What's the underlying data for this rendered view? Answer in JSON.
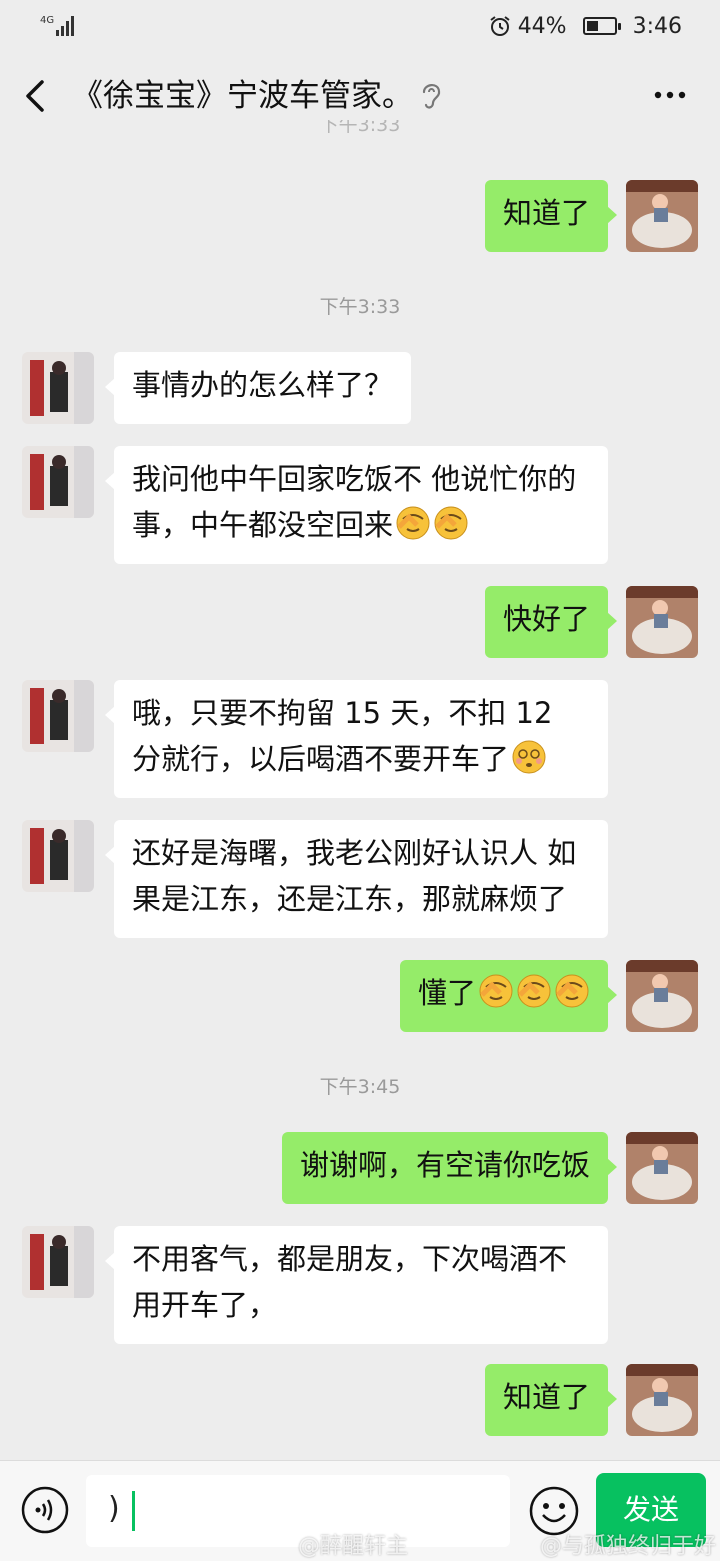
{
  "status_bar": {
    "network": "4G",
    "battery": "44%",
    "battery_level": 0.44,
    "time": "3:46"
  },
  "nav": {
    "title": "《徐宝宝》宁波车管家。",
    "back_icon": "chevron-left-icon",
    "mode_icon": "ear-icon",
    "more_icon": "more-dots-icon"
  },
  "timestamps": {
    "t1": "下午3:33",
    "t2": "下午3:45"
  },
  "messages": [
    {
      "side": "out",
      "text": "知道了"
    },
    {
      "side": "in",
      "text": "事情办的怎么样了？"
    },
    {
      "side": "in",
      "text": "我问他中午回家吃饭不 他说忙你的事，中午都没空回来",
      "emoji": [
        "facepalm",
        "facepalm"
      ]
    },
    {
      "side": "out",
      "text": "快好了"
    },
    {
      "side": "in",
      "text": "哦，只要不拘留 15 天，不扣 12 分就行，以后喝酒不要开车了",
      "emoji": [
        "dizzy"
      ]
    },
    {
      "side": "in",
      "text": "还好是海曙，我老公刚好认识人 如果是江东，还是江东，那就麻烦了"
    },
    {
      "side": "out",
      "text": "懂了",
      "emoji": [
        "facepalm",
        "facepalm",
        "facepalm"
      ]
    },
    {
      "side": "out",
      "text": "谢谢啊，有空请你吃饭"
    },
    {
      "side": "in",
      "text": "不用客气，都是朋友，下次喝酒不用开车了，"
    },
    {
      "side": "out",
      "text": "知道了"
    }
  ],
  "input_bar": {
    "voice_icon": "voice-icon",
    "input_value": ")",
    "emoji_icon": "smiley-icon",
    "send_label": "发送"
  },
  "watermarks": {
    "left": "@醉醒轩主",
    "right": "@与孤独终归于好"
  },
  "colors": {
    "outgoing_bubble": "#95ec69",
    "incoming_bubble": "#ffffff",
    "send_button": "#07c160",
    "background": "#ededed"
  }
}
